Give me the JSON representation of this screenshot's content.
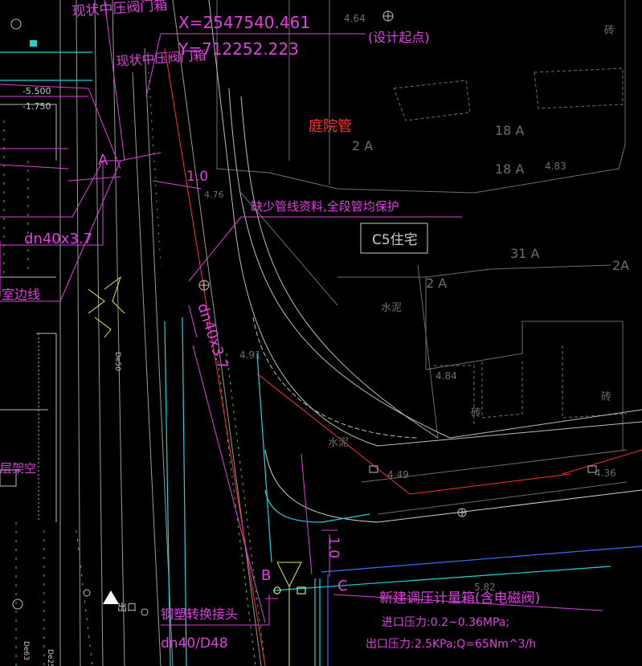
{
  "colors": {
    "background": "#000000",
    "magenta": "#e040e0",
    "white": "#c8c8c8",
    "gray": "#6e6e6e",
    "red": "#ff3030",
    "cyan": "#19d7d7",
    "green": "#2fd24b",
    "yellow": "#e6e650",
    "blue": "#3b6cff"
  },
  "labels": {
    "top_valve_box": "现状中压阀门箱",
    "valve_box": "现状中压阀门箱",
    "coord_x": "X=2547540.461",
    "coord_y": "Y=712252.223",
    "design_start": "(设计起点)",
    "courtyard_pipe": "庭院管",
    "missing_info": "缺少管线资料,全段管均保护",
    "building": "C5住宅",
    "point_a": "A",
    "point_b": "B",
    "point_c": "C",
    "dim_top": "1.0",
    "dim_mid": "1.0",
    "pipe_dn40_left": "dn40x3.7",
    "pipe_dn40_diag": "dn40x3.7",
    "pipe_dn40_d48": "dn40/D48",
    "room_edge_line": "室边线",
    "new_regulator": "新建调压计量箱(含电磁阀)",
    "inlet_pressure": "进口压力:0.2~0.36MPa;",
    "outlet_pressure": "出口压力:2.5KPa;Q=65Nm^3/h",
    "steel_plastic_joint": "钢塑转换接头",
    "exit": "出口",
    "overhead": "层架空",
    "elev_left_1": "-5.500",
    "elev_left_2": "-1.750",
    "elev_4_64": "4.64",
    "elev_4_76": "4.76",
    "elev_4_83": "4.83",
    "elev_4_84": "4.84",
    "elev_4_91": "4.91",
    "elev_4_49": "4.49",
    "elev_4_36": "4.36",
    "elev_5_82": "5.82",
    "room_18a_1": "18 A",
    "room_18a_2": "18 A",
    "room_2a_1": "2 A",
    "room_2a_2": "2 A",
    "room_2a_3": "2A",
    "room_31a": "31 A",
    "brick_1": "砖",
    "brick_2": "砖",
    "brick_3": "砖",
    "cement_1": "水泥",
    "cement_2": "水泥",
    "pipe_de50": "De50",
    "pipe_de63": "De63",
    "pipe_de25": "De25"
  }
}
